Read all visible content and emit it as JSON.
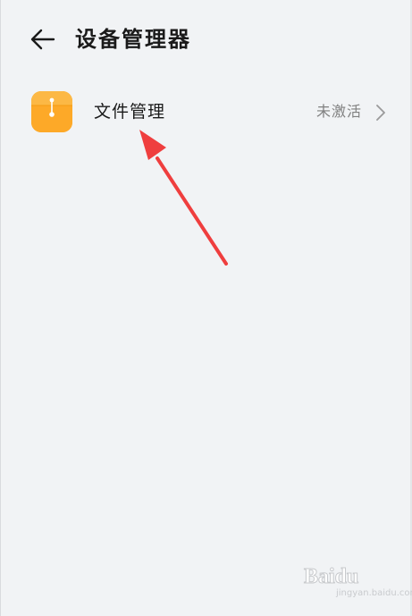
{
  "header": {
    "back_icon": "arrow-left-icon",
    "title": "设备管理器"
  },
  "list": {
    "items": [
      {
        "icon": "file-folder-icon",
        "icon_color": "#fda928",
        "label": "文件管理",
        "status": "未激活",
        "trailing_icon": "chevron-right-icon"
      }
    ]
  },
  "annotation": {
    "arrow_color": "#ef3e3e"
  },
  "watermark": {
    "logo": "Baidu",
    "sub": "jingyan.baidu.com"
  }
}
